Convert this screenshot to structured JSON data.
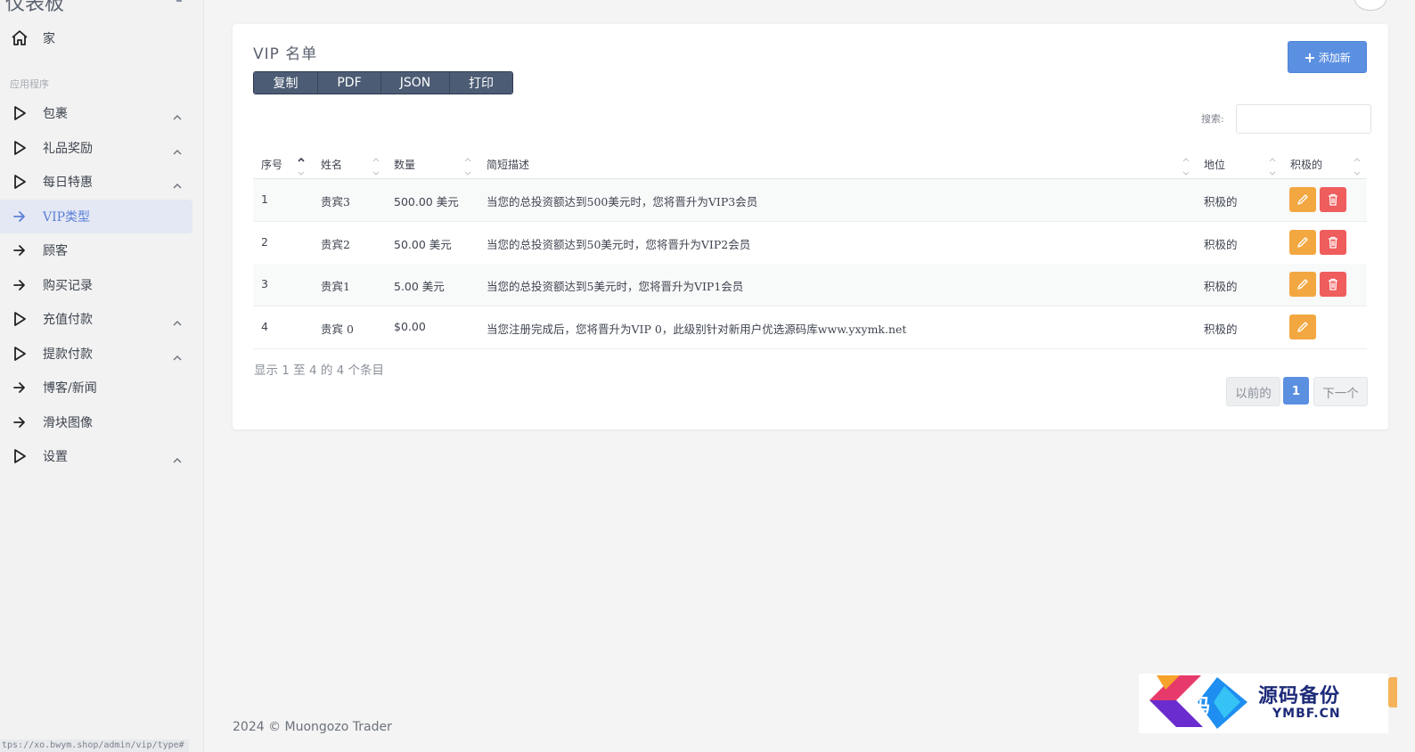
{
  "sidebar": {
    "brand": "仪表板",
    "home_label": "家",
    "section_label": "应用程序",
    "items": [
      {
        "label": "包裹",
        "icon": "play-outline-icon",
        "expandable": true
      },
      {
        "label": "礼品奖励",
        "icon": "play-outline-icon",
        "expandable": true
      },
      {
        "label": "每日特惠",
        "icon": "play-outline-icon",
        "expandable": true
      },
      {
        "label": "VIP类型",
        "icon": "arrow-right-icon",
        "active": true
      },
      {
        "label": "顾客",
        "icon": "arrow-right-icon"
      },
      {
        "label": "购买记录",
        "icon": "arrow-right-icon"
      },
      {
        "label": "充值付款",
        "icon": "play-outline-icon",
        "expandable": true
      },
      {
        "label": "提款付款",
        "icon": "play-outline-icon",
        "expandable": true
      },
      {
        "label": "博客/新闻",
        "icon": "arrow-right-icon"
      },
      {
        "label": "滑块图像",
        "icon": "arrow-right-icon"
      },
      {
        "label": "设置",
        "icon": "play-outline-icon",
        "expandable": true
      }
    ],
    "status_url": "tps://xo.bwym.shop/admin/vip/type#"
  },
  "card": {
    "title": "VIP 名单",
    "add_label": "添加新",
    "export_buttons": [
      "复制",
      "PDF",
      "JSON",
      "打印"
    ],
    "search_label": "搜索:",
    "search_value": "",
    "columns": [
      "序号",
      "姓名",
      "数量",
      "简短描述",
      "地位",
      "积极的"
    ],
    "rows": [
      {
        "id": "1",
        "name": "贵宾3",
        "amount": "500.00 美元",
        "desc": "当您的总投资额达到500美元时，您将晋升为VIP3会员",
        "status": "积极的",
        "deletable": true
      },
      {
        "id": "2",
        "name": "贵宾2",
        "amount": "50.00 美元",
        "desc": "当您的总投资额达到50美元时，您将晋升为VIP2会员",
        "status": "积极的",
        "deletable": true
      },
      {
        "id": "3",
        "name": "贵宾1",
        "amount": "5.00 美元",
        "desc": "当您的总投资额达到5美元时，您将晋升为VIP1会员",
        "status": "积极的",
        "deletable": true
      },
      {
        "id": "4",
        "name": "贵宾 0",
        "amount": "$0.00",
        "desc": "当您注册完成后，您将晋升为VIP 0，此级别针对新用户优选源码库www.yxymk.net",
        "status": "积极的",
        "deletable": false
      }
    ],
    "info": "显示 1 至 4 的 4 个条目",
    "pagination": {
      "prev": "以前的",
      "current": "1",
      "next": "下一个"
    }
  },
  "footer": "2024 © Muongozo Trader",
  "watermark": {
    "char": "码",
    "title": "源码备份",
    "subtitle": "YMBF.CN"
  },
  "colors": {
    "accent": "#5b8fe0",
    "edit": "#f3a741",
    "delete": "#ef5d5d",
    "export": "#4c5c74"
  }
}
